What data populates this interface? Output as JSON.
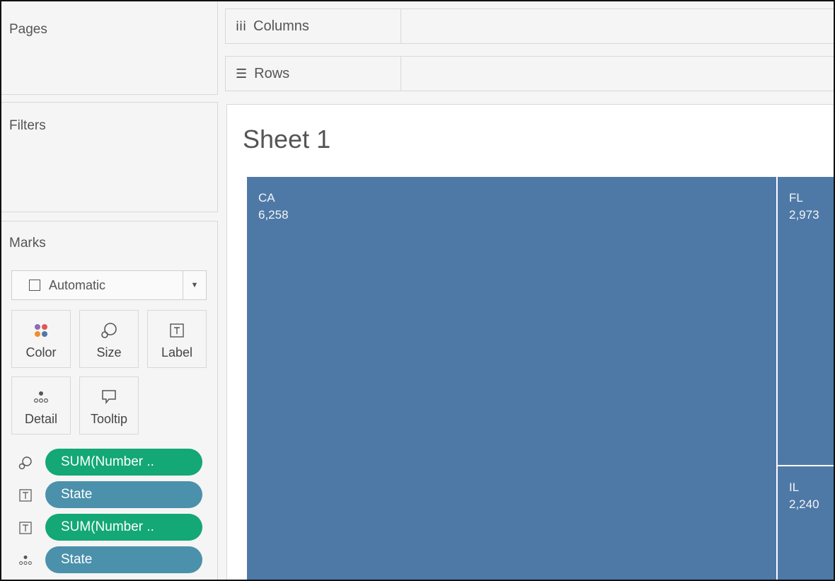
{
  "cards": {
    "pages_title": "Pages",
    "filters_title": "Filters",
    "marks_title": "Marks"
  },
  "shelves": {
    "columns_label": "Columns",
    "rows_label": "Rows"
  },
  "marks": {
    "mark_type": "Automatic",
    "buttons": [
      "Color",
      "Size",
      "Label",
      "Detail",
      "Tooltip"
    ],
    "pills": [
      {
        "icon": "size-icon",
        "text": "SUM(Number ..",
        "kind": "measure"
      },
      {
        "icon": "label-icon",
        "text": "State",
        "kind": "dimension"
      },
      {
        "icon": "label-icon",
        "text": "SUM(Number ..",
        "kind": "measure"
      },
      {
        "icon": "detail-icon",
        "text": "State",
        "kind": "dimension"
      }
    ]
  },
  "view": {
    "sheet_title": "Sheet 1",
    "tiles": [
      {
        "state": "CA",
        "value": "6,258"
      },
      {
        "state": "FL",
        "value": "2,973"
      },
      {
        "state": "IL",
        "value": "2,240"
      }
    ]
  },
  "colors": {
    "tile_fill": "#4e79a7",
    "measure_pill": "#13a876",
    "dimension_pill": "#4b91ab"
  }
}
